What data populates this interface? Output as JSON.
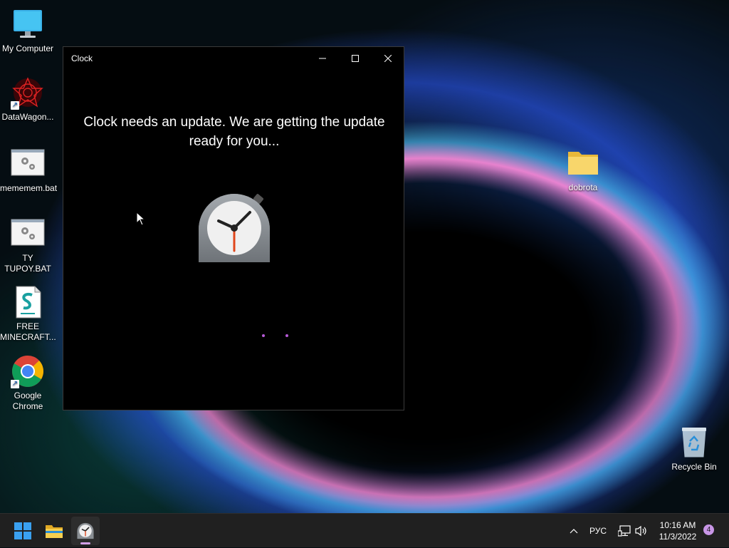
{
  "desktop": {
    "icons": [
      {
        "label": "My Computer",
        "icon": "monitor-icon"
      },
      {
        "label": "DataWagon...",
        "icon": "datawagon-icon",
        "shortcut": true
      },
      {
        "label": "mememem.bat",
        "icon": "batch-file-icon"
      },
      {
        "label": "TY TUPOY.BAT",
        "icon": "batch-file-icon"
      },
      {
        "label": "FREE MINECRAFT...",
        "icon": "script-file-icon"
      },
      {
        "label": "Google Chrome",
        "icon": "chrome-icon",
        "shortcut": true
      },
      {
        "label": "dobrota",
        "icon": "folder-icon"
      },
      {
        "label": "Recycle Bin",
        "icon": "recycle-bin-icon"
      }
    ]
  },
  "window": {
    "title": "Clock",
    "message": "Clock needs an update. We are getting the update ready for you...",
    "controls": [
      "minimize-icon",
      "maximize-icon",
      "close-icon"
    ]
  },
  "taskbar": {
    "apps": [
      "start-icon",
      "file-explorer-icon",
      "clock-app-icon"
    ],
    "tray": {
      "language": "РУС",
      "time": "10:16 AM",
      "date": "11/3/2022",
      "notification_count": "4"
    }
  },
  "colors": {
    "window_bg": "#000000",
    "taskbar_bg": "#202020",
    "accent": "#c896e6",
    "loading_dots": "#b65ad6"
  }
}
